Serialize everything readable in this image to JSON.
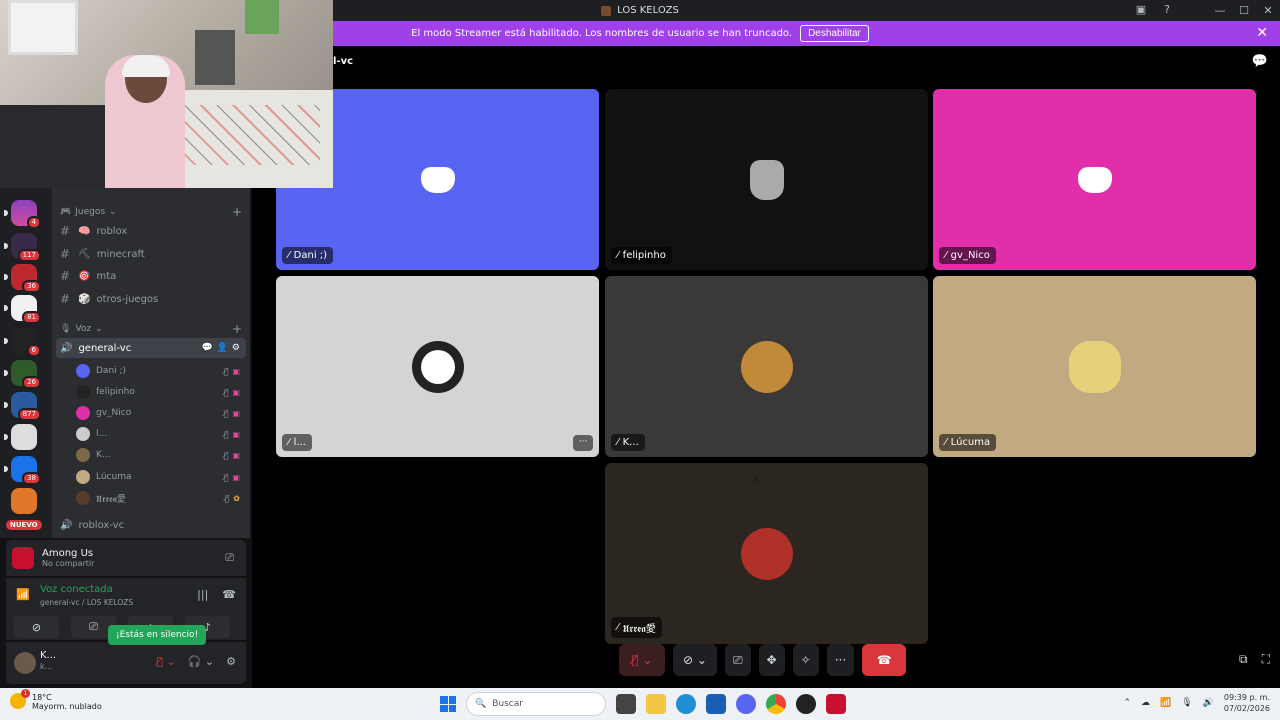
{
  "window": {
    "title": "LOS KELOZS",
    "controls": [
      "—",
      "☐",
      "✕"
    ]
  },
  "banner": {
    "text": "El modo Streamer está habilitado. Los nombres de usuario se han truncado.",
    "button": "Deshabilitar"
  },
  "servers": [
    {
      "badge": "4"
    },
    {
      "badge": "117"
    },
    {
      "badge": "36"
    },
    {
      "badge": "81"
    },
    {
      "badge": "6"
    },
    {
      "badge": "26"
    },
    {
      "badge": "877"
    },
    {
      "badge": ""
    },
    {
      "badge": "38"
    },
    {
      "badge": ""
    }
  ],
  "new_badge": "NUEVO",
  "sidebar": {
    "category_games": "Juegos",
    "text_channels": [
      "roblox",
      "minecraft",
      "mta",
      "otros-juegos"
    ],
    "category_voice": "Voz",
    "active_voice": "general-vc",
    "voice_users": [
      "Dani ;)",
      "felipinho",
      "gv_Nico",
      "l...",
      "K...",
      "Lúcuma",
      "𝖀𝖗𝖗𝖊𝖆愛"
    ],
    "other_voice": "roblox-vc"
  },
  "activity": {
    "game": "Among Us",
    "status": "No compartir"
  },
  "voice_panel": {
    "title": "Voz conectada",
    "subtitle": "general-vc / LOS KELOZS"
  },
  "user_panel": {
    "name": "K...",
    "sub": "k..."
  },
  "tooltip": "¡Estás en silencio!",
  "stage": {
    "title": "l-vc",
    "tiles": [
      {
        "name": "Dani ;)",
        "bg": "#5865f2"
      },
      {
        "name": "felipinho",
        "bg": "#111111"
      },
      {
        "name": "gv_Nico",
        "bg": "#e12faa"
      },
      {
        "name": "l...",
        "bg": "#d4d4d4"
      },
      {
        "name": "K...",
        "bg": "#3a3938"
      },
      {
        "name": "Lúcuma",
        "bg": "#c2a982"
      },
      {
        "name": "𝖀𝖗𝖗𝖊𝖆愛",
        "bg": "#2c2620"
      }
    ]
  },
  "taskbar": {
    "temp": "18°C",
    "weather": "Mayorm. nublado",
    "search_placeholder": "Buscar",
    "time": "09:39 p. m.",
    "date": "07/02/2026"
  }
}
